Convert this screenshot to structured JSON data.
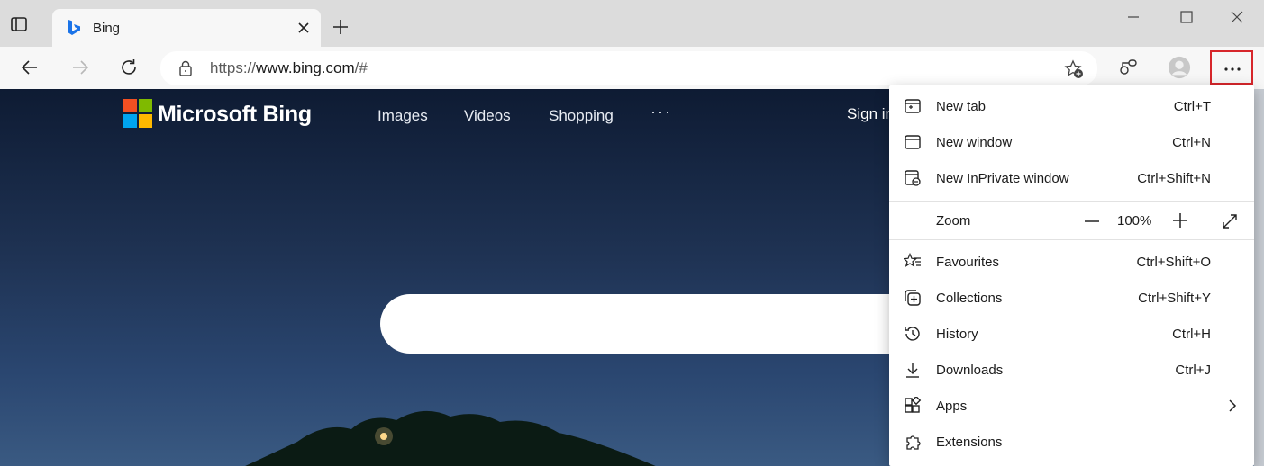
{
  "browser": {
    "tab": {
      "title": "Bing"
    },
    "address": {
      "scheme": "https://",
      "host": "www.bing.com",
      "path": "/#"
    },
    "window_controls": [
      "minimize-icon",
      "maximize-icon",
      "close-icon"
    ]
  },
  "bing": {
    "brand": "Microsoft Bing",
    "nav": [
      "Images",
      "Videos",
      "Shopping"
    ],
    "more": "···",
    "signin": "Sign in"
  },
  "menu": {
    "items": [
      {
        "label": "New tab",
        "shortcut": "Ctrl+T",
        "icon": "new-tab-icon"
      },
      {
        "label": "New window",
        "shortcut": "Ctrl+N",
        "icon": "new-window-icon"
      },
      {
        "label": "New InPrivate window",
        "shortcut": "Ctrl+Shift+N",
        "icon": "inprivate-icon"
      }
    ],
    "zoom": {
      "label": "Zoom",
      "value": "100%"
    },
    "items2": [
      {
        "label": "Favourites",
        "shortcut": "Ctrl+Shift+O",
        "icon": "favourites-icon"
      },
      {
        "label": "Collections",
        "shortcut": "Ctrl+Shift+Y",
        "icon": "collections-icon"
      },
      {
        "label": "History",
        "shortcut": "Ctrl+H",
        "icon": "history-icon"
      },
      {
        "label": "Downloads",
        "shortcut": "Ctrl+J",
        "icon": "downloads-icon"
      },
      {
        "label": "Apps",
        "shortcut": "",
        "icon": "apps-icon"
      },
      {
        "label": "Extensions",
        "shortcut": "",
        "icon": "extensions-icon"
      }
    ]
  },
  "colors": {
    "highlight": "#d7262b",
    "bing_red": "#f25022",
    "bing_green": "#7fba00",
    "bing_blue": "#00a4ef",
    "bing_yellow": "#ffb900"
  }
}
